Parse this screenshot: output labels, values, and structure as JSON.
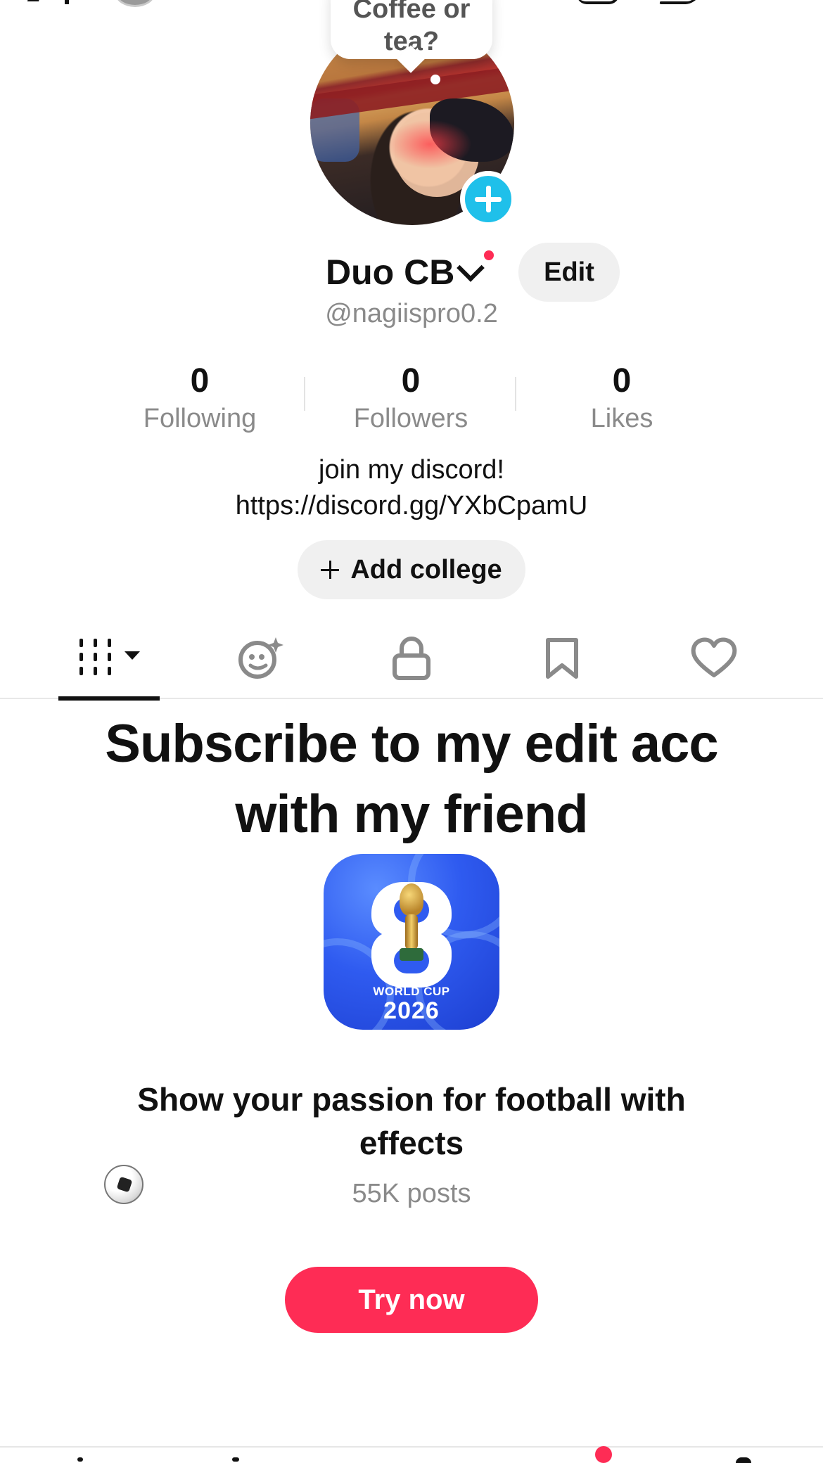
{
  "tooltip": {
    "text": "Coffee or\ntea?"
  },
  "profile": {
    "display_name": "Duo CB",
    "edit_label": "Edit",
    "username": "@nagiispro0.2"
  },
  "stats": [
    {
      "value": "0",
      "label": "Following"
    },
    {
      "value": "0",
      "label": "Followers"
    },
    {
      "value": "0",
      "label": "Likes"
    }
  ],
  "bio": {
    "line1": "join my discord!",
    "line2": "https://discord.gg/YXbCpamU"
  },
  "add_college_label": "Add college",
  "tabs": [
    {
      "name": "videos-grid",
      "icon": "grid-bars-icon",
      "active": true
    },
    {
      "name": "reposts",
      "icon": "sparkle-face-icon",
      "active": false
    },
    {
      "name": "private",
      "icon": "lock-icon",
      "active": false
    },
    {
      "name": "favorites",
      "icon": "bookmark-icon",
      "active": false
    },
    {
      "name": "liked",
      "icon": "heart-icon",
      "active": false
    }
  ],
  "promo": {
    "title_line1": "Subscribe to my edit acc",
    "title_line2": "with my friend",
    "app_label_line1": "WORLD CUP",
    "app_label_line2": "2026",
    "subtitle_line1": "Show your passion for football with",
    "subtitle_line2": "effects",
    "subtitle_emoji": "soccer-ball-icon",
    "count": "55K posts",
    "cta_label": "Try now"
  },
  "colors": {
    "accent": "#fe2c55",
    "add_badge": "#1fc0ea",
    "muted_text": "#8a8a8a",
    "chip_bg": "#f0f0f0"
  }
}
